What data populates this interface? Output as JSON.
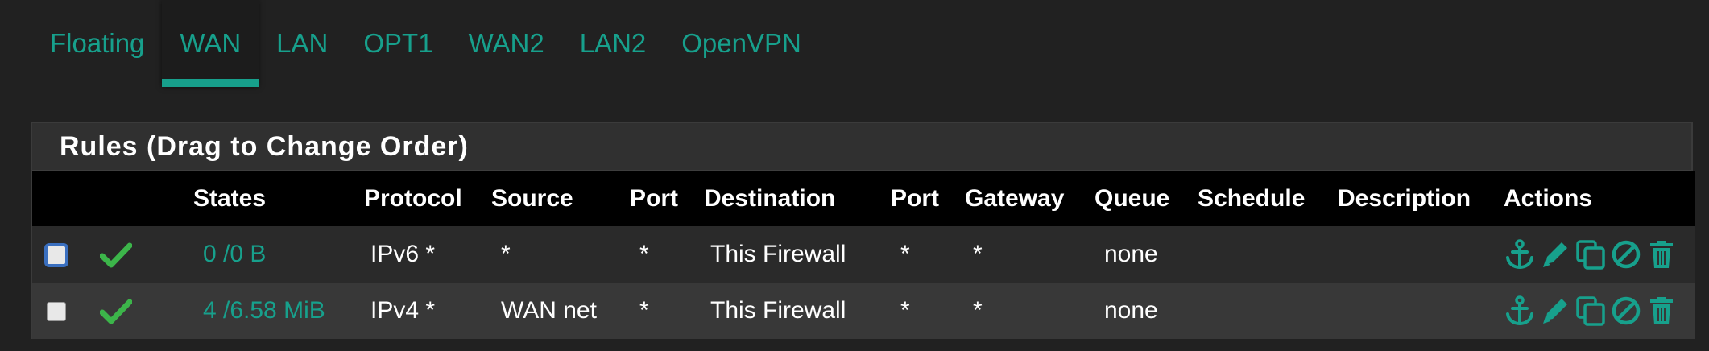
{
  "tabs": [
    {
      "label": "Floating",
      "active": false
    },
    {
      "label": "WAN",
      "active": true
    },
    {
      "label": "LAN",
      "active": false
    },
    {
      "label": "OPT1",
      "active": false
    },
    {
      "label": "WAN2",
      "active": false
    },
    {
      "label": "LAN2",
      "active": false
    },
    {
      "label": "OpenVPN",
      "active": false
    }
  ],
  "panel": {
    "title": "Rules (Drag to Change Order)"
  },
  "columns": {
    "states": "States",
    "protocol": "Protocol",
    "source": "Source",
    "port": "Port",
    "destination": "Destination",
    "dest_port": "Port",
    "gateway": "Gateway",
    "queue": "Queue",
    "schedule": "Schedule",
    "description": "Description",
    "actions": "Actions"
  },
  "rows": [
    {
      "selected_focus": true,
      "enabled_icon": "checkmark-icon",
      "states": "0 /0 B",
      "protocol": "IPv6 *",
      "source": "*",
      "port": "*",
      "destination": "This Firewall",
      "dest_port": "*",
      "gateway": "*",
      "queue": "none",
      "schedule": "",
      "description": ""
    },
    {
      "selected_focus": false,
      "enabled_icon": "checkmark-icon",
      "states": "4 /6.58 MiB",
      "protocol": "IPv4 *",
      "source": "WAN net",
      "port": "*",
      "destination": "This Firewall",
      "dest_port": "*",
      "gateway": "*",
      "queue": "none",
      "schedule": "",
      "description": ""
    }
  ],
  "action_icons": [
    "anchor-icon",
    "pencil-icon",
    "copy-icon",
    "disable-icon",
    "trash-icon"
  ],
  "colors": {
    "accent": "#17a08c",
    "background": "#212121",
    "check_green": "#3cb54a"
  }
}
